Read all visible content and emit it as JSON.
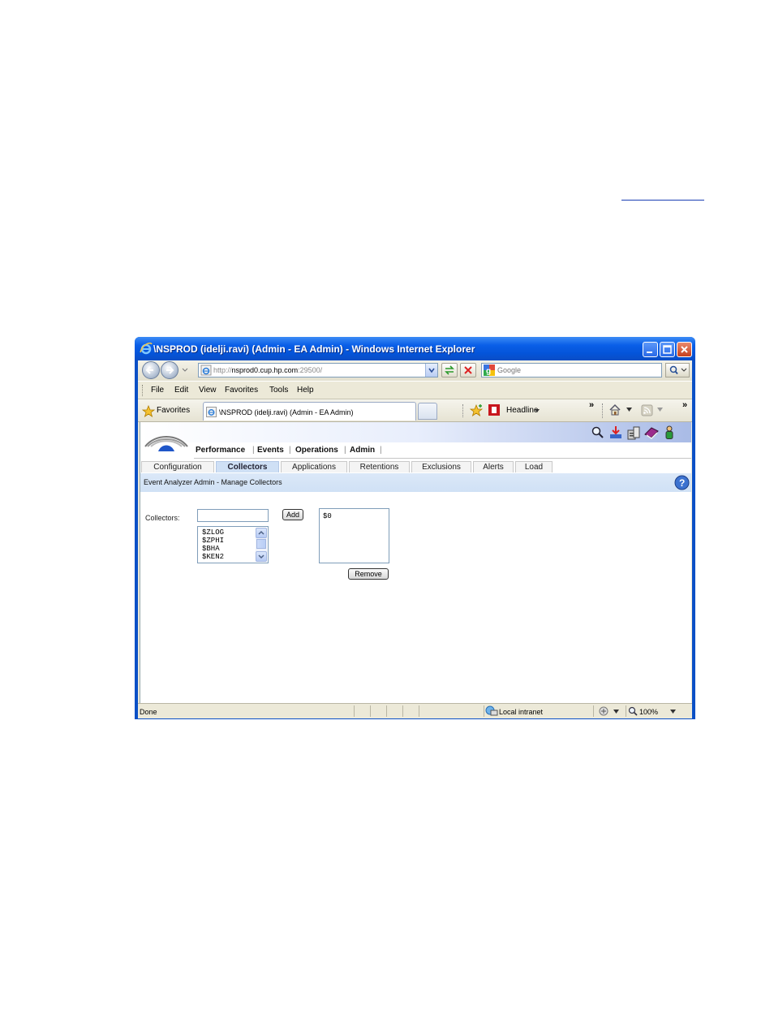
{
  "window": {
    "title": "\\NSPROD (idelji.ravi) (Admin - EA Admin) - Windows Internet Explorer"
  },
  "address_bar": {
    "url_prefix": "http://",
    "url_host": "nsprod0.cup.hp.com",
    "url_suffix": ":29500/"
  },
  "search": {
    "placeholder": "Google"
  },
  "menu": {
    "items": [
      "File",
      "Edit",
      "View",
      "Favorites",
      "Tools",
      "Help"
    ]
  },
  "favorites_bar": {
    "favorites_label": "Favorites",
    "tab_title": "\\NSPROD (idelji.ravi) (Admin - EA Admin)",
    "headline_label": "Headline"
  },
  "app": {
    "main_nav": [
      "Performance",
      "Events",
      "Operations",
      "Admin"
    ],
    "subtabs": [
      "Configuration",
      "Collectors",
      "Applications",
      "Retentions",
      "Exclusions",
      "Alerts",
      "Load"
    ],
    "active_subtab": "Collectors",
    "page_title": "Event Analyzer Admin - Manage Collectors",
    "collectors_label": "Collectors:",
    "add_label": "Add",
    "remove_label": "Remove",
    "available_collectors": [
      "$ZLOG",
      "$ZPHI",
      "$BHA",
      "$KEN2"
    ],
    "selected_collectors": [
      "$0"
    ]
  },
  "status_bar": {
    "status": "Done",
    "zone": "Local intranet",
    "zoom": "100%"
  },
  "colors": {
    "titlebar": "#0a5fe8",
    "active_subtab": "#cfe0f5",
    "title_band": "#d0e1f5"
  }
}
